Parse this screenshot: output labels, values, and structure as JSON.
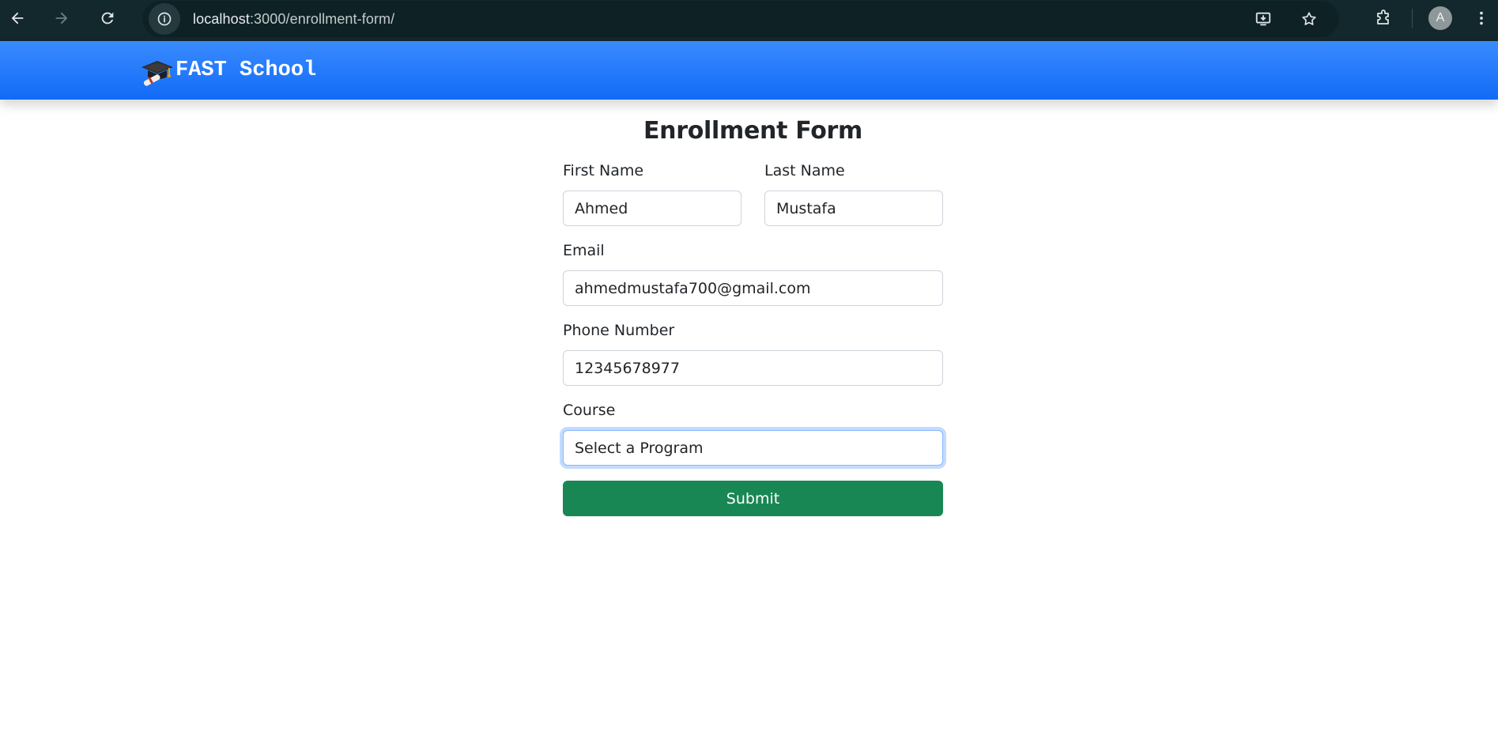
{
  "browser": {
    "url_host": "localhost",
    "url_path": ":3000/enrollment-form/",
    "profile_initial": "A"
  },
  "header": {
    "brand": "FAST School",
    "brand_color": "#1a6ef8"
  },
  "form": {
    "title": "Enrollment Form",
    "first_name": {
      "label": "First Name",
      "value": "Ahmed"
    },
    "last_name": {
      "label": "Last Name",
      "value": "Mustafa"
    },
    "email": {
      "label": "Email",
      "value": "ahmedmustafa700@gmail.com"
    },
    "phone": {
      "label": "Phone Number",
      "value": "12345678977"
    },
    "course": {
      "label": "Course",
      "value": "Select a Program"
    },
    "submit_label": "Submit",
    "submit_color": "#198754"
  }
}
